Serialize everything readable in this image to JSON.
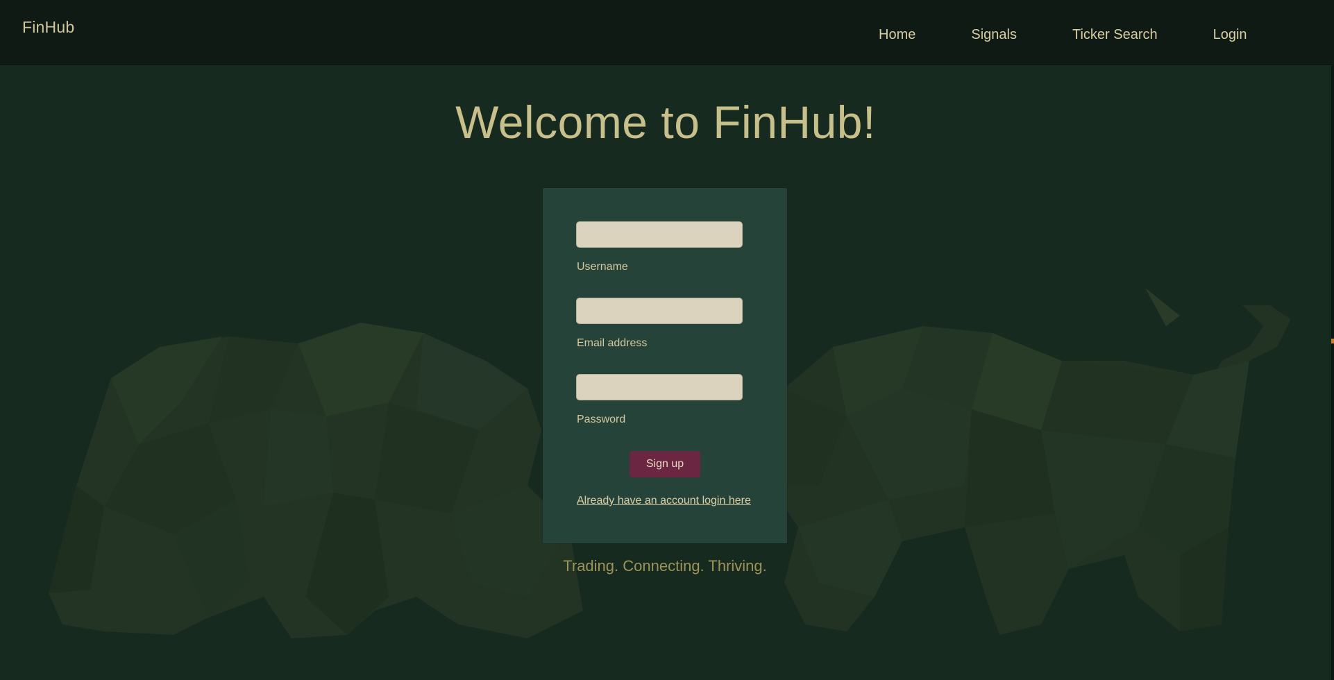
{
  "navbar": {
    "brand": "FinHub",
    "links": [
      "Home",
      "Signals",
      "Ticker Search",
      "Login"
    ]
  },
  "hero": {
    "title": "Welcome to FinHub!"
  },
  "form": {
    "fields": [
      {
        "label": "Username",
        "value": "",
        "type": "text"
      },
      {
        "label": "Email address",
        "value": "",
        "type": "email"
      },
      {
        "label": "Password",
        "value": "",
        "type": "password"
      }
    ],
    "submit_label": "Sign up",
    "login_link": "Already have an account login here"
  },
  "tagline": "Trading. Connecting. Thriving.",
  "colors": {
    "background": "#172a1f",
    "navbar": "#0f1a15",
    "card": "#26433a",
    "accent_button": "#6b2742",
    "text_gold": "#c8c08c"
  },
  "icons": {
    "bear_art": "bear-polygon-art",
    "bull_art": "bull-polygon-art"
  }
}
